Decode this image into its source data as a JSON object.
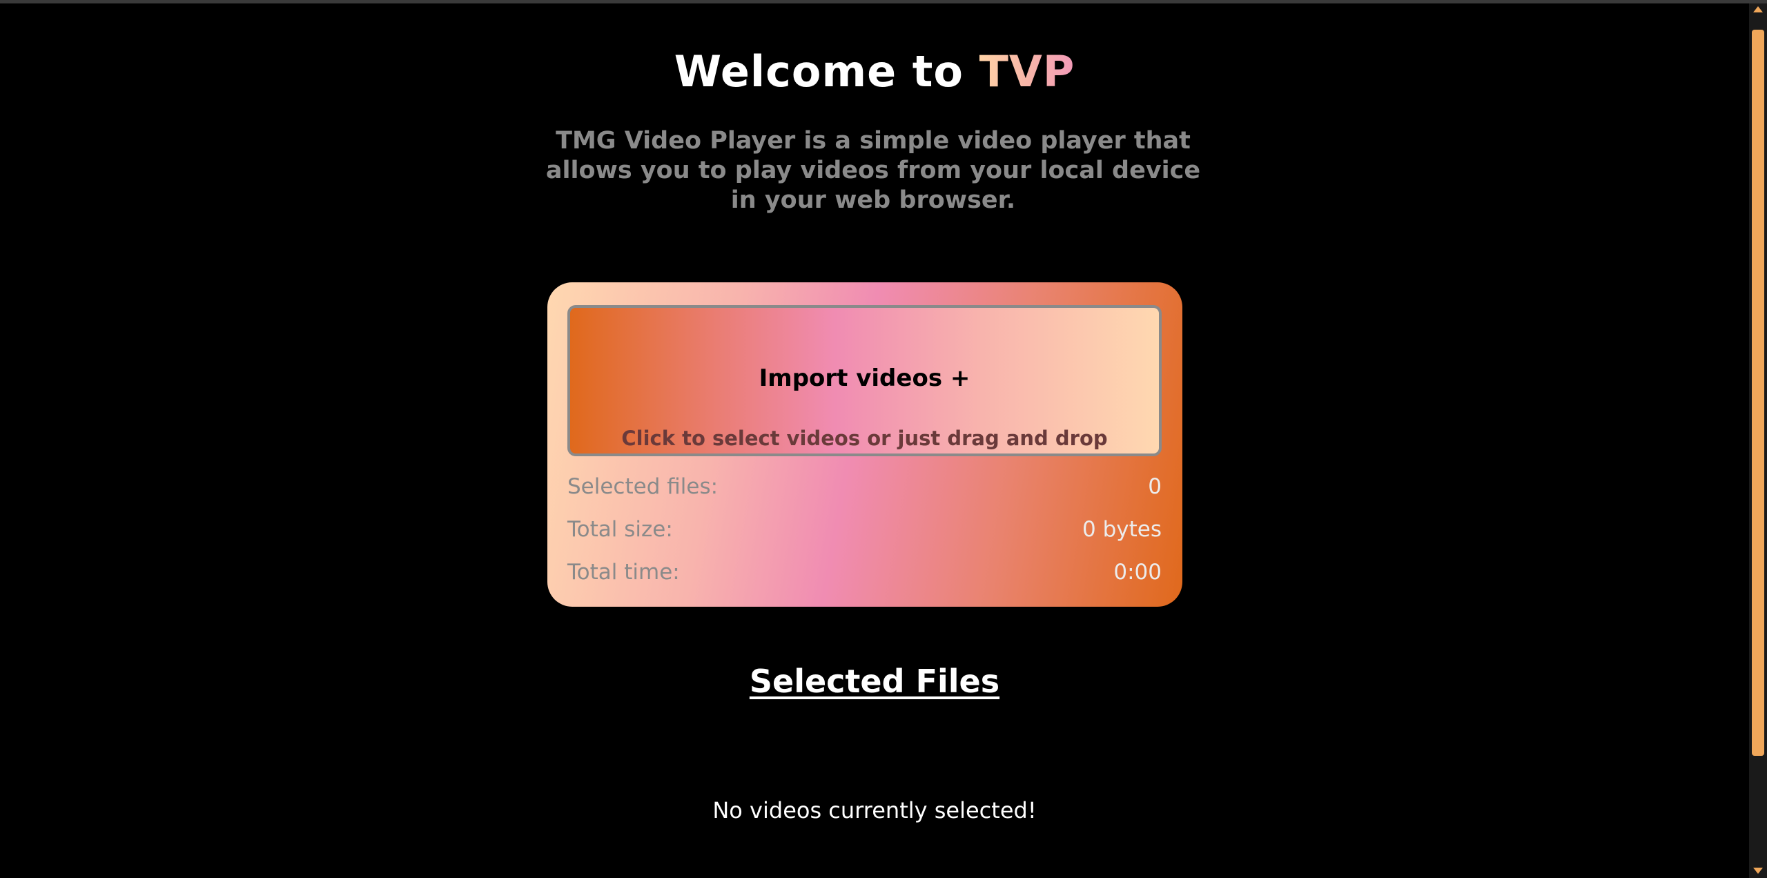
{
  "header": {
    "title_prefix": "Welcome to ",
    "title_brand": "TVP",
    "subtitle": "TMG Video Player is a simple video player that allows you to play videos from your local device in your web browser."
  },
  "importer": {
    "title": "Import videos +",
    "hint": "Click to select videos or just drag and drop"
  },
  "stats": [
    {
      "label": "Selected files:",
      "value": "0"
    },
    {
      "label": "Total size:",
      "value": "0 bytes"
    },
    {
      "label": "Total time:",
      "value": "0:00"
    }
  ],
  "selected": {
    "heading": "Selected Files",
    "empty_message": "No videos currently selected!"
  },
  "colors": {
    "accent": "#f0a75a",
    "gradient_peach": "#ffd8b0",
    "gradient_pink": "#f08cb2",
    "gradient_orange": "#e0691c"
  }
}
